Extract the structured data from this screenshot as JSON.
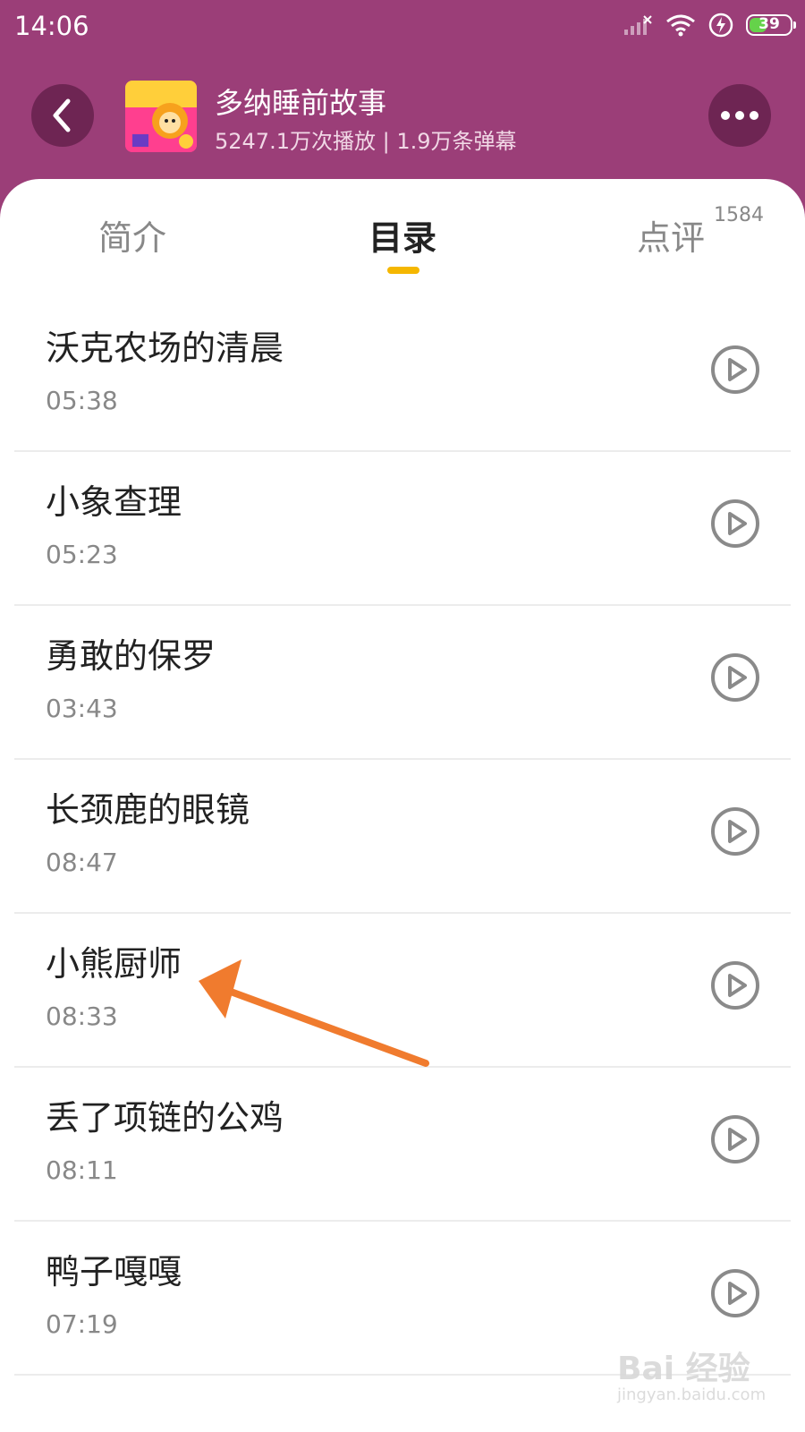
{
  "status_bar": {
    "time": "14:06",
    "battery": "39"
  },
  "header": {
    "album_title": "多纳睡前故事",
    "album_stats": "5247.1万次播放 | 1.9万条弹幕"
  },
  "tabs": {
    "intro": "简介",
    "catalog": "目录",
    "review": "点评",
    "review_count": "1584"
  },
  "stories": [
    {
      "title": "沃克农场的清晨",
      "duration": "05:38"
    },
    {
      "title": "小象查理",
      "duration": "05:23"
    },
    {
      "title": "勇敢的保罗",
      "duration": "03:43"
    },
    {
      "title": "长颈鹿的眼镜",
      "duration": "08:47"
    },
    {
      "title": "小熊厨师",
      "duration": "08:33"
    },
    {
      "title": "丢了项链的公鸡",
      "duration": "08:11"
    },
    {
      "title": "鸭子嘎嘎",
      "duration": "07:19"
    }
  ],
  "watermark": {
    "main": "Bai 经验",
    "sub": "jingyan.baidu.com"
  },
  "colors": {
    "header_bg": "#9b3e78",
    "active_tab_indicator": "#f5b700",
    "arrow": "#f07b2e"
  }
}
